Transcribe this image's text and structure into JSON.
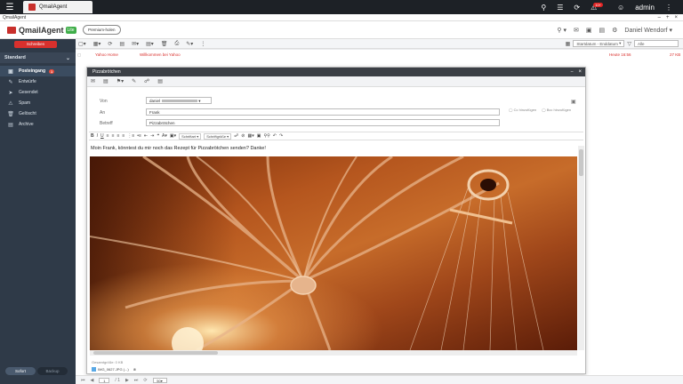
{
  "os": {
    "tab_title": "QmailAgent",
    "user": "admin",
    "badge": "10+"
  },
  "app": {
    "window_title": "QmailAgent",
    "logo": "QmailAgent",
    "lite": "Lite",
    "premium": "Premium-holen",
    "account": "Daniel Wendorf"
  },
  "sidebar": {
    "compose": "Schreiben",
    "account": "Standard",
    "folders": [
      {
        "label": "Posteingang",
        "count": "1"
      },
      {
        "label": "Entwürfe"
      },
      {
        "label": "Gesendet"
      },
      {
        "label": "Spam"
      },
      {
        "label": "Gelöscht"
      },
      {
        "label": "Archive"
      }
    ],
    "footer": {
      "active": "Sofort",
      "inactive": "Backup"
    }
  },
  "listbar": {
    "sort": "Startdatum - Enddatum",
    "filter": "Alle"
  },
  "mail_row": {
    "from": "Yahoo Home",
    "subject": "Willkommen bei Yahoo",
    "date": "Heute 16:56",
    "size": "27 KB"
  },
  "compose": {
    "title": "Pizzabrötchen",
    "from_label": "Von",
    "from_value": "daniel",
    "to_label": "An",
    "to_value": "Frank",
    "subject_label": "Betreff",
    "subject_value": "Pizzabrötchen",
    "cc": "Cc hinzufügen",
    "bcc": "Bcc hinzufügen",
    "font": "Schriftart",
    "size": "Schriftgröße",
    "body": "Moin Frank, könntest du mir noch das Rezept für Pizzabrötchen senden? Danke!",
    "attach_label": "Gesamtgröße: 0 KB",
    "attach_file": "IMG_0627.JPG (...)"
  },
  "pager": {
    "page": "1",
    "total": "/ 1",
    "per_page": "50"
  }
}
